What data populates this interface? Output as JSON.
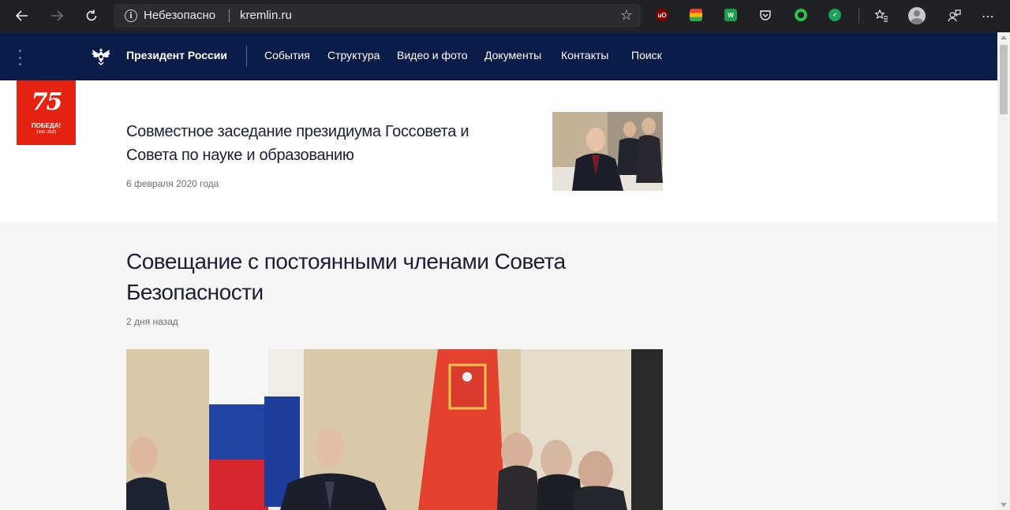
{
  "browser": {
    "security_label": "Небезопасно",
    "url": "kremlin.ru",
    "extensions": [
      {
        "name": "ublock-origin",
        "label": "uO",
        "color": "#800000"
      },
      {
        "name": "google-apps",
        "label": "",
        "color": "#f4b400"
      },
      {
        "name": "word-extension",
        "label": "W",
        "color": "#1e9e4a"
      },
      {
        "name": "pocket",
        "label": "",
        "color": "#202124"
      },
      {
        "name": "circle-extension",
        "label": "",
        "color": "#2fbf4a"
      },
      {
        "name": "grammar-extension",
        "label": "",
        "color": "#1ba35a"
      }
    ]
  },
  "header": {
    "site_title": "Президент России",
    "nav": [
      {
        "label": "События"
      },
      {
        "label": "Структура"
      },
      {
        "label": "Видео и фото"
      },
      {
        "label": "Документы"
      },
      {
        "label": "Контакты"
      },
      {
        "label": "Поиск"
      }
    ]
  },
  "badge": {
    "number": "75",
    "word": "ПОБЕДА!",
    "years": "1945–2020",
    "color": "#e42313"
  },
  "articles": [
    {
      "title": "Совместное заседание президиума Госсовета и Совета по науке и образованию",
      "date": "6 февраля 2020 года"
    },
    {
      "title": "Совещание с постоянными членами Совета Безопасности",
      "date": "2 дня назад"
    }
  ],
  "colors": {
    "header_bg": "#0c1c49",
    "chrome_bg": "#202124",
    "page_bg": "#f6f6f6"
  }
}
